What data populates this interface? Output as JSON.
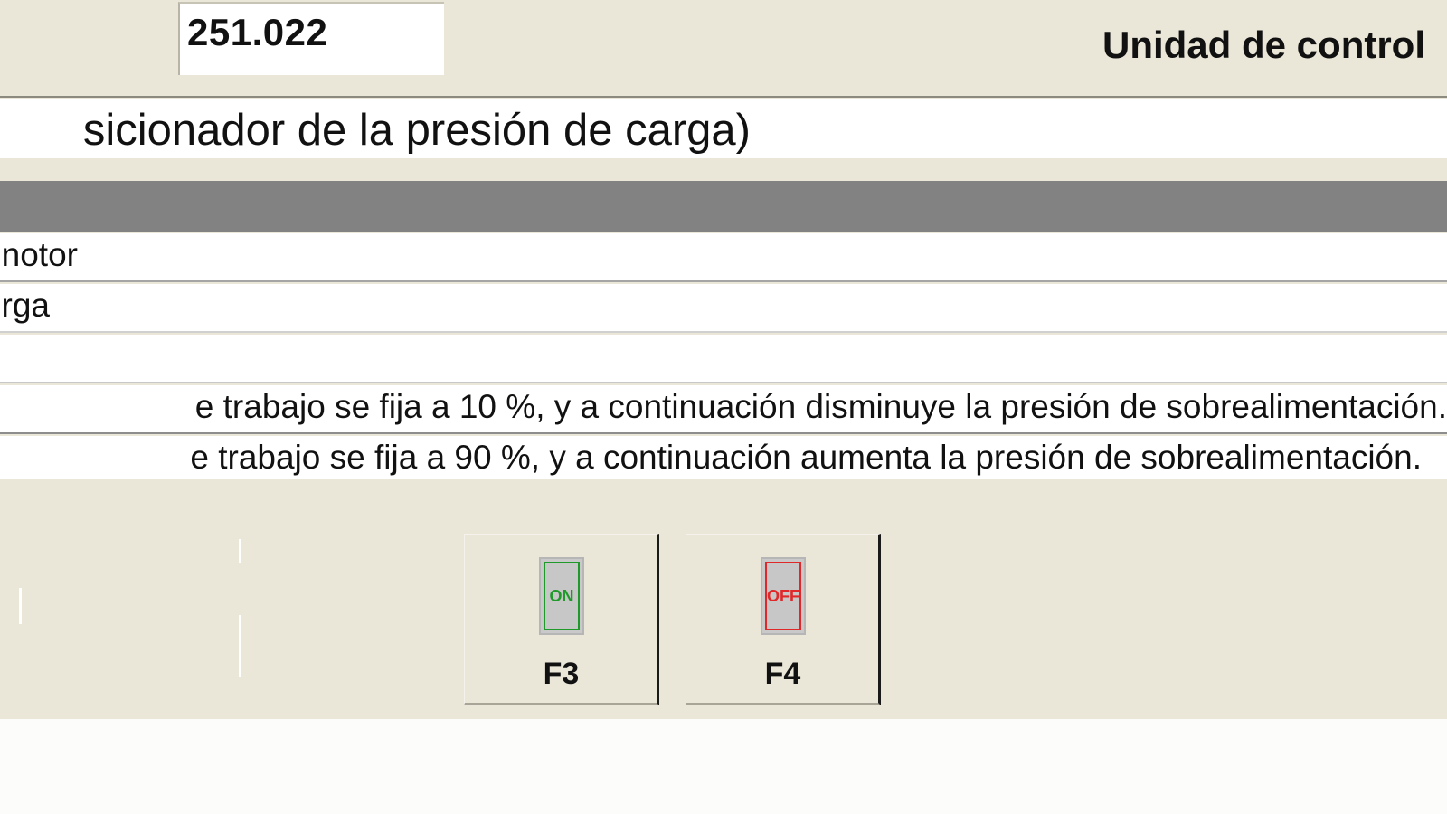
{
  "header": {
    "code_value": "251.022",
    "control_unit_label": "Unidad de control"
  },
  "title": {
    "text": "sicionador de la presión de carga)"
  },
  "table": {
    "rows": [
      {
        "text": "notor"
      },
      {
        "text": "rga"
      },
      {
        "text": ""
      },
      {
        "text": "e trabajo se fija a 10 %, y a continuación disminuye la presión de sobrealimentación."
      },
      {
        "text": "e trabajo se fija a 90 %, y a continuación aumenta la presión de sobrealimentación."
      }
    ]
  },
  "function_keys": {
    "f3": {
      "label": "F3",
      "icon_text": "ON",
      "icon": "switch-on-icon",
      "color": "#1f9a2a"
    },
    "f4": {
      "label": "F4",
      "icon_text": "OFF",
      "icon": "switch-off-icon",
      "color": "#e0282a"
    }
  }
}
